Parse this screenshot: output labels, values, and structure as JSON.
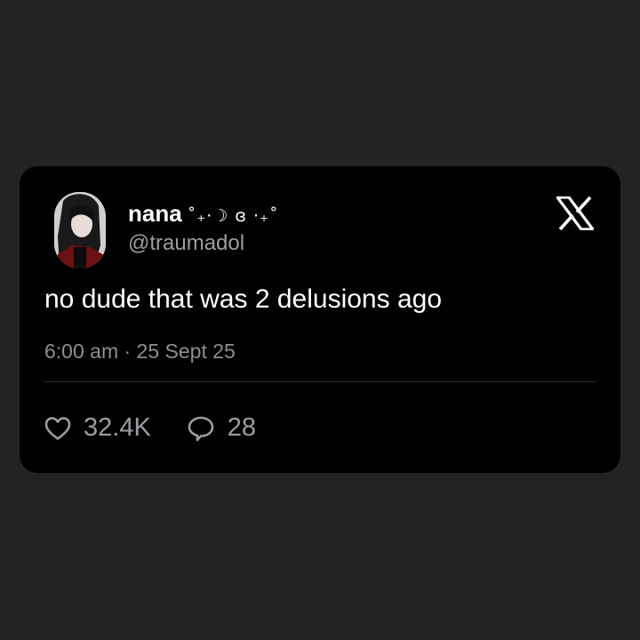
{
  "tweet": {
    "author": {
      "display_name": "nana",
      "name_decoration": "˚₊‧☽ ɞ ‧₊˚",
      "handle": "@traumadol",
      "avatar_icon": "profile-photo"
    },
    "platform_icon": "x-logo-icon",
    "text": "no dude that was 2 delusions ago",
    "timestamp": "6:00 am · 25 Sept 25",
    "metrics": {
      "likes": "32.4K",
      "replies": "28"
    }
  },
  "colors": {
    "background": "#232323",
    "card": "#000000",
    "primary_text": "#ffffff",
    "secondary_text": "#9a9ea3",
    "divider": "#2f3336"
  }
}
